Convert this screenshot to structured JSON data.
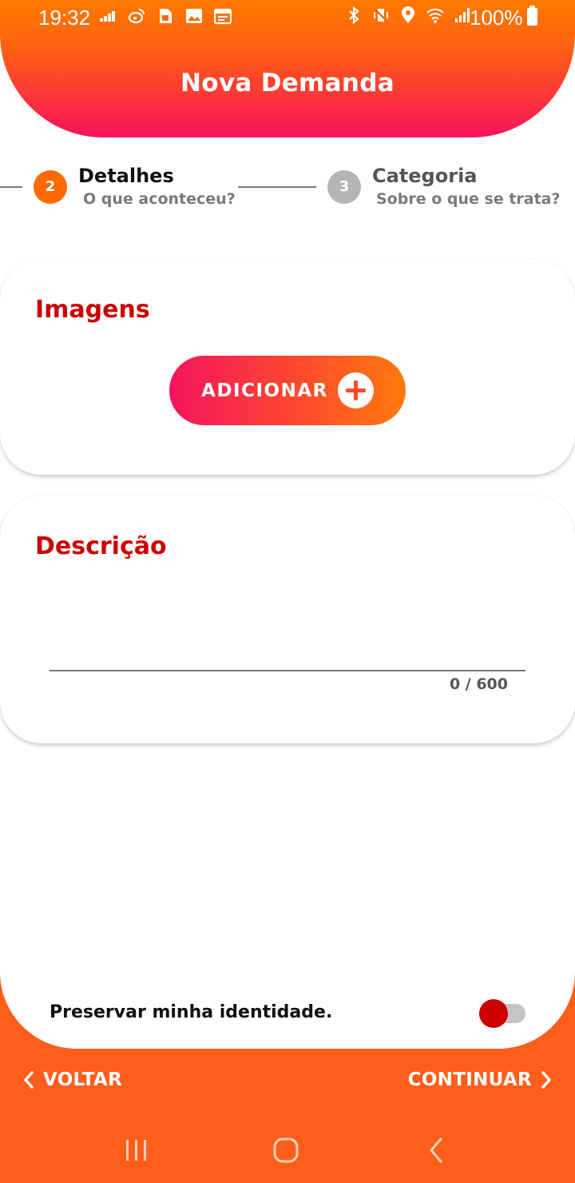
{
  "status_bar": {
    "time": "19:32",
    "battery": "100%",
    "left_icons": [
      "deezer-icon",
      "weibo-icon",
      "sim-card-icon",
      "gallery-icon",
      "calendar-icon"
    ],
    "right_icons": [
      "bluetooth-icon",
      "vibrate-icon",
      "location-icon",
      "wifi-icon",
      "signal-icon"
    ]
  },
  "header": {
    "title": "Nova Demanda"
  },
  "stepper": {
    "steps": [
      {
        "number": "2",
        "title": "Detalhes",
        "subtitle": "O que aconteceu?",
        "active": true
      },
      {
        "number": "3",
        "title": "Categoria",
        "subtitle": "Sobre o que se trata?",
        "active": false
      }
    ]
  },
  "images_card": {
    "title": "Imagens",
    "add_button_label": "ADICIONAR"
  },
  "description_card": {
    "title": "Descrição",
    "value": "",
    "counter": "0 / 600"
  },
  "preserve_identity": {
    "label": "Preservar minha identidade.",
    "enabled": false
  },
  "footer": {
    "back_label": "VOLTAR",
    "continue_label": "CONTINUAR"
  },
  "colors": {
    "accent_orange": "#ff6a00",
    "accent_pink": "#f5145e",
    "title_red": "#cc0000",
    "step_active": "#ff6a00",
    "step_inactive": "#b5b5b5",
    "footer_bg": "#ff5e1a"
  }
}
